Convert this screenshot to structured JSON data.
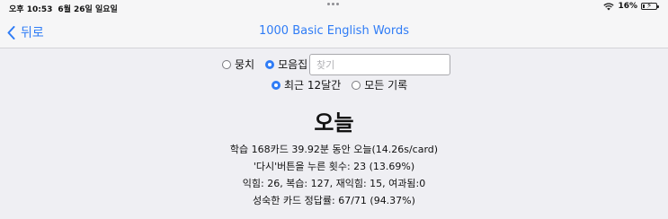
{
  "status_bar": {
    "time": "오후 10:53",
    "date": "6월 26일 일요일",
    "battery_percent": "16%",
    "battery_level": 0.16,
    "wifi_icon": "wifi-icon",
    "battery_icon": "battery-charging-icon"
  },
  "nav": {
    "back_label": "뒤로",
    "title": "1000 Basic English Words"
  },
  "scope_options": [
    {
      "label": "뭉치",
      "checked": false
    },
    {
      "label": "모음집",
      "checked": true
    }
  ],
  "search": {
    "placeholder": "찾기",
    "value": ""
  },
  "period_options": [
    {
      "label": "최근 12달간",
      "checked": true
    },
    {
      "label": "모든 기록",
      "checked": false
    }
  ],
  "heading": "오늘",
  "stats": {
    "line1": "학습 168카드 39.92분 동안 오늘(14.26s/card)",
    "line2": "'다시'버튼을 누른 횟수: 23 (13.69%)",
    "line3": "익힘: 26, 복습: 127, 재익힘: 15, 여과됨:0",
    "line4": "성숙한 카드 정답률: 67/71 (94.37%)"
  },
  "colors": {
    "accent": "#2f7cf6",
    "background": "#efeff3",
    "bar": "#f6f6f7"
  }
}
